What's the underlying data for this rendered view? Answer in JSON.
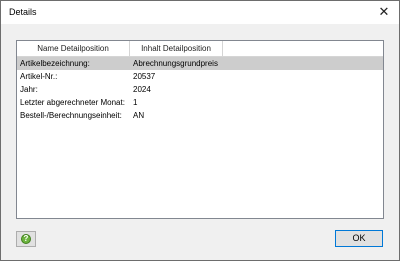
{
  "window": {
    "title": "Details",
    "close_glyph": "✕"
  },
  "table": {
    "columns": [
      "Name Detailposition",
      "Inhalt Detailposition"
    ],
    "rows": [
      {
        "name": "Artikelbezeichnung:",
        "value": "Abrechnungsgrundpreis",
        "selected": true
      },
      {
        "name": "Artikel-Nr.:",
        "value": "20537",
        "selected": false
      },
      {
        "name": "Jahr:",
        "value": "2024",
        "selected": false
      },
      {
        "name": "Letzter abgerechneter Monat:",
        "value": "1",
        "selected": false
      },
      {
        "name": "Bestell-/Berechnungseinheit:",
        "value": "AN",
        "selected": false
      }
    ]
  },
  "buttons": {
    "help_icon": "help-icon",
    "help_glyph": "?",
    "ok_label": "OK"
  },
  "colors": {
    "selected_row": "#cdcdcd",
    "help_icon": "#6cb33f",
    "ok_border": "#0078d7"
  }
}
